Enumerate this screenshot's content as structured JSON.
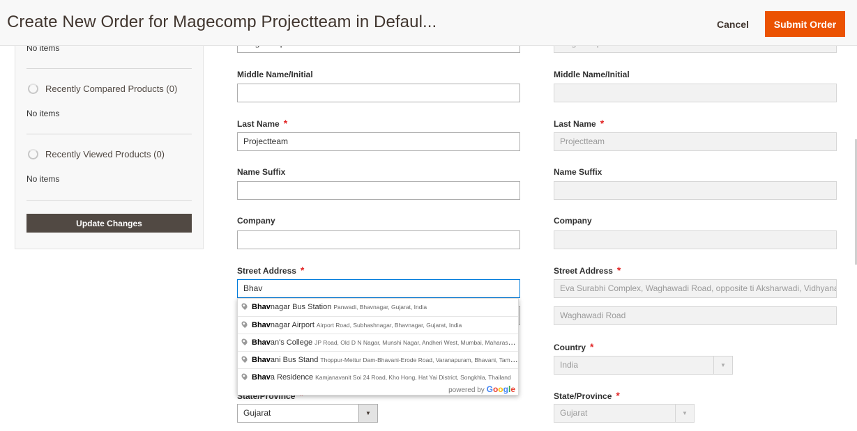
{
  "header": {
    "title": "Create New Order for Magecomp Projectteam in Defaul...",
    "cancel_label": "Cancel",
    "submit_label": "Submit Order"
  },
  "sidebar": {
    "top_no_items": "No items",
    "compared": {
      "heading": "Recently Compared Products (0)",
      "empty": "No items"
    },
    "viewed": {
      "heading": "Recently Viewed Products (0)",
      "empty": "No items"
    },
    "update_label": "Update Changes"
  },
  "billing": {
    "first_name_value": "Magecomp",
    "middle_label": "Middle Name/Initial",
    "middle_value": "",
    "last_label": "Last Name",
    "last_value": "Projectteam",
    "suffix_label": "Name Suffix",
    "suffix_value": "",
    "company_label": "Company",
    "company_value": "",
    "street_label": "Street Address",
    "street_value": "Bhav",
    "state_label": "State/Province",
    "state_value": "Gujarat"
  },
  "shipping": {
    "first_name_value": "Magecomp",
    "middle_label": "Middle Name/Initial",
    "last_label": "Last Name",
    "last_value": "Projectteam",
    "suffix_label": "Name Suffix",
    "company_label": "Company",
    "street_label": "Street Address",
    "street_line1": "Eva Surabhi Complex, Waghawadi Road, opposite ti Aksharwadi, Vidhyanagar",
    "street_line2": "Waghawadi Road",
    "country_label": "Country",
    "country_value": "India",
    "state_label": "State/Province",
    "state_value": "Gujarat"
  },
  "required_mark": "*",
  "autocomplete": {
    "items": [
      {
        "match": "Bhav",
        "rest": "nagar Bus Station",
        "secondary": "Panwadi, Bhavnagar, Gujarat, India"
      },
      {
        "match": "Bhav",
        "rest": "nagar Airport",
        "secondary": "Airport Road, Subhashnagar, Bhavnagar, Gujarat, India"
      },
      {
        "match": "Bhav",
        "rest": "an's College",
        "secondary": "JP Road, Old D N Nagar, Munshi Nagar, Andheri West, Mumbai, Maharashtra, India"
      },
      {
        "match": "Bhav",
        "rest": "ani Bus Stand",
        "secondary": "Thoppur-Mettur Dam-Bhavani-Erode Road, Varanapuram, Bhavani, Tamil Nadu, India"
      },
      {
        "match": "Bhav",
        "rest": "a Residence",
        "secondary": "Kamjanavanit Soi 24 Road, Kho Hong, Hat Yai District, Songkhla, Thailand"
      }
    ],
    "powered_by": "powered by",
    "google": [
      "G",
      "o",
      "o",
      "g",
      "l",
      "e"
    ]
  },
  "colors": {
    "accent": "#eb5202",
    "update_button": "#514943",
    "required": "#e22626"
  }
}
